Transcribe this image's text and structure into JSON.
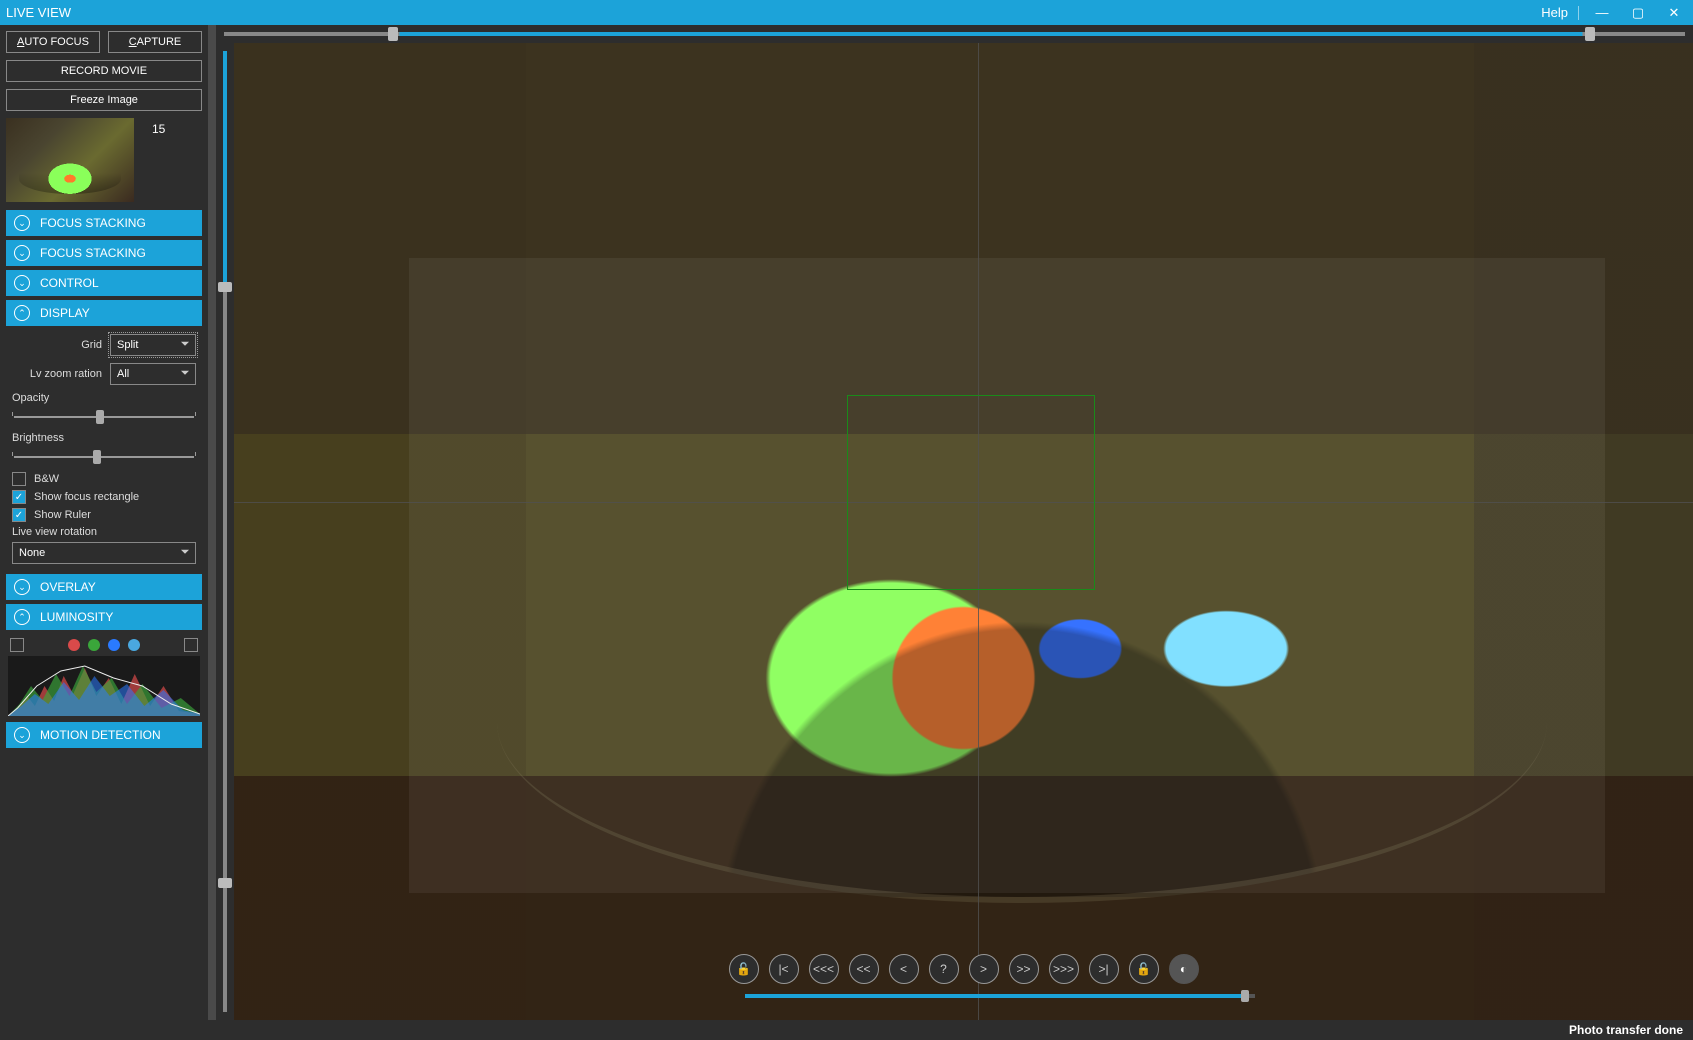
{
  "title": "LIVE VIEW",
  "titlebar": {
    "help": "Help"
  },
  "buttons": {
    "autofocus_pre": "A",
    "autofocus_post": "UTO FOCUS",
    "capture_pre": "C",
    "capture_post": "APTURE",
    "record": "RECORD MOVIE",
    "freeze": "Freeze Image"
  },
  "thumb": {
    "count": "15"
  },
  "panels": {
    "focus1": "FOCUS STACKING",
    "focus2": "FOCUS STACKING",
    "control": "CONTROL",
    "display": "DISPLAY",
    "overlay": "OVERLAY",
    "luminosity": "LUMINOSITY",
    "motion": "MOTION DETECTION"
  },
  "display": {
    "grid_label": "Grid",
    "grid_value": "Split",
    "zoom_label": "Lv zoom ration",
    "zoom_value": "All",
    "opacity_label": "Opacity",
    "opacity_pct": 48,
    "brightness_label": "Brightness",
    "brightness_pct": 46,
    "bw_label": "B&W",
    "bw_checked": false,
    "focusrect_label": "Show focus rectangle",
    "focusrect_checked": true,
    "ruler_label": "Show Ruler",
    "ruler_checked": true,
    "rotation_label": "Live view rotation",
    "rotation_value": "None"
  },
  "luminosity": {
    "colors": [
      "#d94a4a",
      "#3aa63a",
      "#2a7aff",
      "#4aa8e0"
    ]
  },
  "top_ruler": {
    "a_pct": 12,
    "b_pct": 93
  },
  "left_ruler": {
    "a_pct": 25,
    "b_pct": 86
  },
  "nav": {
    "lock1_icon": "🔓",
    "first_icon": "|<",
    "rew3": "<<<",
    "rew2": "<<",
    "rew1": "<",
    "help": "?",
    "fwd1": ">",
    "fwd2": ">>",
    "fwd3": ">>>",
    "last_icon": ">|",
    "lock2_icon": "🔓",
    "contrast_icon": "◐"
  },
  "progress_pct": 98,
  "status": "Photo transfer done"
}
